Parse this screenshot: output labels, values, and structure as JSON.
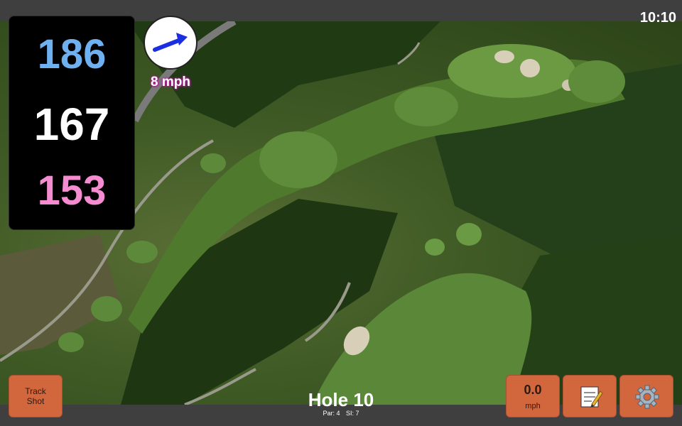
{
  "status": {
    "time": "10:10"
  },
  "distances": {
    "back": "186",
    "middle": "167",
    "front": "153"
  },
  "wind": {
    "speed_label": "8 mph",
    "icon": "wind-arrow-icon"
  },
  "track_button": {
    "label_line1": "Track",
    "label_line2": "Shot"
  },
  "speed_button": {
    "value": "0.0",
    "unit": "mph"
  },
  "notes_button": {
    "icon": "notepad-icon"
  },
  "settings_button": {
    "icon": "gear-icon"
  },
  "hole": {
    "title": "Hole 10",
    "par": "Par: 4",
    "si": "SI: 7"
  },
  "colors": {
    "back_distance": "#6fb1f0",
    "middle_distance": "#ffffff",
    "front_distance": "#f58cd1",
    "button": "#d2673e",
    "wind_label_glow": "#b11d9a"
  }
}
